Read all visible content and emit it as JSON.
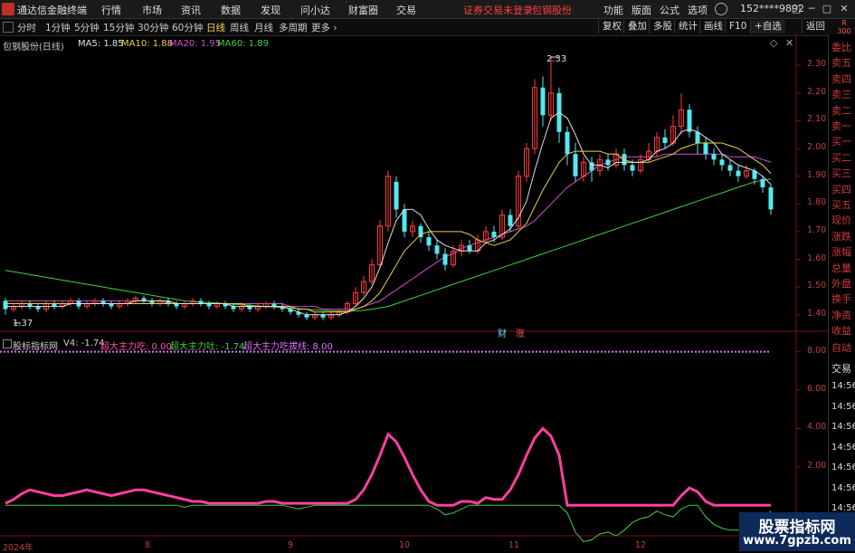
{
  "app": {
    "title": "通达信金融终端"
  },
  "menu": [
    "行情",
    "市场",
    "资讯",
    "数据",
    "发现",
    "问小达",
    "财富圈",
    "交易"
  ],
  "login_notice": "证券交易未登录",
  "stock_name": "包钢股份",
  "menu_right": [
    "功能",
    "版面",
    "公式",
    "选项"
  ],
  "user_id": "152****9892",
  "window_buttons": [
    "□",
    "─",
    "▢",
    "✕"
  ],
  "periods": [
    "分时",
    "1分钟",
    "5分钟",
    "15分钟",
    "30分钟",
    "60分钟",
    "日线",
    "周线",
    "月线",
    "多周期",
    "更多 ›"
  ],
  "active_period": "日线",
  "toolbar_right": [
    "复权",
    "叠加",
    "多股",
    "统计",
    "画线",
    "F10",
    "+自选",
    "返回"
  ],
  "badge": {
    "line1": "R",
    "line2": "300"
  },
  "main_info": {
    "label": "包钢股份(日线)",
    "ma": [
      {
        "text": "MA5: 1.85",
        "color": "#e0e0e0"
      },
      {
        "text": "MA10: 1.88",
        "color": "#e6d24a"
      },
      {
        "text": "MA20: 1.95",
        "color": "#d54ad5"
      },
      {
        "text": "MA60: 1.89",
        "color": "#3fd13f"
      }
    ]
  },
  "indicator_info": {
    "label": "股标指标网",
    "v4": "V4: -1.74",
    "items": [
      {
        "text": "超大主力吃: 0.00",
        "color": "#ff4fa0"
      },
      {
        "text": "超大主力吐: -1.74",
        "color": "#3fd13f"
      },
      {
        "text": "超大主力吃拔线: 8.00",
        "color": "#e070ff"
      }
    ]
  },
  "price_axis": [
    "2.30",
    "2.20",
    "2.10",
    "2.00",
    "1.90",
    "1.80",
    "1.70",
    "1.60",
    "1.50",
    "1.40"
  ],
  "ind_axis": [
    "8.00",
    "6.00",
    "4.00",
    "2.00"
  ],
  "annotations": {
    "high": "2.33",
    "low": "1.37",
    "mark_cai": "财",
    "mark_zhang": "涨"
  },
  "x_labels": [
    "2024年",
    "8",
    "9",
    "10",
    "11",
    "12"
  ],
  "side_panel": [
    "委比",
    "卖五",
    "卖四",
    "卖三",
    "卖二",
    "卖一",
    "买一",
    "买二",
    "买三",
    "买四",
    "买五",
    "现价",
    "涨跌",
    "涨幅",
    "总量",
    "外盘",
    "换手",
    "净资",
    "收益"
  ],
  "side_panel2": [
    "自动",
    "交易",
    "14:56",
    "14:56",
    "14:56",
    "14:56",
    "14:56",
    "14:56",
    "14:56",
    "14:56"
  ],
  "watermark": {
    "line1": "股票指标网",
    "line2": "www.7gpzb.com"
  },
  "chart_data": {
    "type": "candlestick",
    "price_range": [
      1.36,
      2.34
    ],
    "candles": [
      [
        1.45,
        1.42,
        1.46,
        1.4
      ],
      [
        1.42,
        1.43,
        1.44,
        1.41
      ],
      [
        1.43,
        1.44,
        1.45,
        1.42
      ],
      [
        1.44,
        1.43,
        1.45,
        1.42
      ],
      [
        1.43,
        1.42,
        1.44,
        1.41
      ],
      [
        1.42,
        1.44,
        1.45,
        1.41
      ],
      [
        1.44,
        1.43,
        1.45,
        1.42
      ],
      [
        1.43,
        1.44,
        1.45,
        1.42
      ],
      [
        1.44,
        1.45,
        1.46,
        1.43
      ],
      [
        1.45,
        1.43,
        1.46,
        1.42
      ],
      [
        1.43,
        1.44,
        1.45,
        1.42
      ],
      [
        1.44,
        1.45,
        1.46,
        1.43
      ],
      [
        1.45,
        1.44,
        1.46,
        1.43
      ],
      [
        1.44,
        1.43,
        1.45,
        1.42
      ],
      [
        1.43,
        1.44,
        1.45,
        1.42
      ],
      [
        1.44,
        1.45,
        1.46,
        1.43
      ],
      [
        1.45,
        1.46,
        1.47,
        1.44
      ],
      [
        1.46,
        1.45,
        1.47,
        1.44
      ],
      [
        1.45,
        1.44,
        1.46,
        1.43
      ],
      [
        1.44,
        1.45,
        1.46,
        1.43
      ],
      [
        1.45,
        1.44,
        1.46,
        1.43
      ],
      [
        1.44,
        1.43,
        1.45,
        1.42
      ],
      [
        1.43,
        1.44,
        1.45,
        1.42
      ],
      [
        1.44,
        1.45,
        1.46,
        1.43
      ],
      [
        1.45,
        1.44,
        1.46,
        1.43
      ],
      [
        1.44,
        1.43,
        1.45,
        1.42
      ],
      [
        1.43,
        1.44,
        1.45,
        1.42
      ],
      [
        1.44,
        1.43,
        1.45,
        1.42
      ],
      [
        1.43,
        1.42,
        1.44,
        1.41
      ],
      [
        1.42,
        1.43,
        1.44,
        1.41
      ],
      [
        1.43,
        1.42,
        1.44,
        1.41
      ],
      [
        1.42,
        1.43,
        1.44,
        1.41
      ],
      [
        1.43,
        1.44,
        1.45,
        1.42
      ],
      [
        1.44,
        1.43,
        1.45,
        1.42
      ],
      [
        1.43,
        1.42,
        1.44,
        1.41
      ],
      [
        1.42,
        1.41,
        1.43,
        1.4
      ],
      [
        1.41,
        1.4,
        1.42,
        1.39
      ],
      [
        1.4,
        1.39,
        1.41,
        1.38
      ],
      [
        1.39,
        1.4,
        1.41,
        1.38
      ],
      [
        1.4,
        1.39,
        1.41,
        1.38
      ],
      [
        1.39,
        1.4,
        1.41,
        1.38
      ],
      [
        1.4,
        1.41,
        1.42,
        1.39
      ],
      [
        1.41,
        1.44,
        1.45,
        1.4
      ],
      [
        1.44,
        1.48,
        1.5,
        1.43
      ],
      [
        1.48,
        1.52,
        1.54,
        1.47
      ],
      [
        1.52,
        1.58,
        1.6,
        1.51
      ],
      [
        1.58,
        1.72,
        1.74,
        1.57
      ],
      [
        1.72,
        1.9,
        1.92,
        1.7
      ],
      [
        1.88,
        1.78,
        1.9,
        1.75
      ],
      [
        1.78,
        1.7,
        1.8,
        1.68
      ],
      [
        1.7,
        1.72,
        1.74,
        1.68
      ],
      [
        1.72,
        1.68,
        1.73,
        1.66
      ],
      [
        1.68,
        1.65,
        1.7,
        1.63
      ],
      [
        1.65,
        1.62,
        1.67,
        1.6
      ],
      [
        1.62,
        1.58,
        1.64,
        1.56
      ],
      [
        1.58,
        1.63,
        1.65,
        1.57
      ],
      [
        1.63,
        1.65,
        1.67,
        1.61
      ],
      [
        1.65,
        1.63,
        1.67,
        1.62
      ],
      [
        1.63,
        1.67,
        1.69,
        1.62
      ],
      [
        1.67,
        1.7,
        1.72,
        1.66
      ],
      [
        1.7,
        1.68,
        1.72,
        1.66
      ],
      [
        1.68,
        1.76,
        1.78,
        1.67
      ],
      [
        1.76,
        1.72,
        1.78,
        1.7
      ],
      [
        1.72,
        1.9,
        1.92,
        1.71
      ],
      [
        1.9,
        2.0,
        2.02,
        1.88
      ],
      [
        2.0,
        2.22,
        2.25,
        1.98
      ],
      [
        2.22,
        2.12,
        2.26,
        2.08
      ],
      [
        2.12,
        2.2,
        2.33,
        2.1
      ],
      [
        2.2,
        2.06,
        2.22,
        2.02
      ],
      [
        2.06,
        1.98,
        2.08,
        1.94
      ],
      [
        1.98,
        1.9,
        2.02,
        1.88
      ],
      [
        1.9,
        1.95,
        1.97,
        1.88
      ],
      [
        1.95,
        1.92,
        1.97,
        1.88
      ],
      [
        1.92,
        1.96,
        1.98,
        1.9
      ],
      [
        1.96,
        1.94,
        1.98,
        1.92
      ],
      [
        1.94,
        1.98,
        2.0,
        1.93
      ],
      [
        1.98,
        1.94,
        2.0,
        1.92
      ],
      [
        1.94,
        1.92,
        1.96,
        1.9
      ],
      [
        1.92,
        1.96,
        1.98,
        1.91
      ],
      [
        1.96,
        1.99,
        2.02,
        1.95
      ],
      [
        1.99,
        2.04,
        2.06,
        1.97
      ],
      [
        2.04,
        2.02,
        2.07,
        2.0
      ],
      [
        2.02,
        2.08,
        2.12,
        2.01
      ],
      [
        2.08,
        2.14,
        2.2,
        2.05
      ],
      [
        2.14,
        2.06,
        2.16,
        2.04
      ],
      [
        2.06,
        2.02,
        2.08,
        1.98
      ],
      [
        2.02,
        1.98,
        2.04,
        1.96
      ],
      [
        1.98,
        1.96,
        2.0,
        1.94
      ],
      [
        1.96,
        1.94,
        1.98,
        1.92
      ],
      [
        1.94,
        1.92,
        1.96,
        1.9
      ],
      [
        1.92,
        1.9,
        1.94,
        1.88
      ],
      [
        1.9,
        1.92,
        1.94,
        1.89
      ],
      [
        1.92,
        1.89,
        1.93,
        1.87
      ],
      [
        1.89,
        1.86,
        1.9,
        1.84
      ],
      [
        1.86,
        1.78,
        1.87,
        1.76
      ]
    ],
    "ma5": [
      1.43,
      1.43,
      1.43,
      1.43,
      1.43,
      1.43,
      1.43,
      1.43,
      1.44,
      1.44,
      1.44,
      1.44,
      1.44,
      1.44,
      1.44,
      1.44,
      1.45,
      1.45,
      1.45,
      1.45,
      1.45,
      1.44,
      1.44,
      1.44,
      1.44,
      1.44,
      1.44,
      1.44,
      1.43,
      1.43,
      1.43,
      1.43,
      1.43,
      1.43,
      1.43,
      1.42,
      1.41,
      1.4,
      1.4,
      1.4,
      1.4,
      1.4,
      1.41,
      1.43,
      1.46,
      1.5,
      1.57,
      1.66,
      1.74,
      1.78,
      1.78,
      1.76,
      1.71,
      1.67,
      1.65,
      1.64,
      1.63,
      1.63,
      1.63,
      1.66,
      1.67,
      1.69,
      1.71,
      1.75,
      1.81,
      1.92,
      2.02,
      2.11,
      2.13,
      2.11,
      2.05,
      1.98,
      1.94,
      1.94,
      1.93,
      1.95,
      1.95,
      1.95,
      1.95,
      1.96,
      1.99,
      2.0,
      2.02,
      2.06,
      2.07,
      2.06,
      2.04,
      2.02,
      1.98,
      1.96,
      1.94,
      1.93,
      1.92,
      1.9,
      1.87
    ],
    "ma10": [
      1.44,
      1.44,
      1.44,
      1.44,
      1.44,
      1.44,
      1.44,
      1.44,
      1.44,
      1.44,
      1.44,
      1.44,
      1.44,
      1.44,
      1.44,
      1.44,
      1.44,
      1.44,
      1.44,
      1.44,
      1.44,
      1.44,
      1.44,
      1.44,
      1.44,
      1.44,
      1.44,
      1.44,
      1.44,
      1.44,
      1.43,
      1.43,
      1.43,
      1.43,
      1.43,
      1.43,
      1.42,
      1.42,
      1.41,
      1.41,
      1.41,
      1.41,
      1.41,
      1.42,
      1.43,
      1.45,
      1.48,
      1.53,
      1.58,
      1.63,
      1.66,
      1.69,
      1.7,
      1.7,
      1.7,
      1.7,
      1.7,
      1.69,
      1.67,
      1.66,
      1.65,
      1.66,
      1.67,
      1.7,
      1.73,
      1.79,
      1.85,
      1.9,
      1.95,
      1.98,
      1.99,
      1.99,
      1.99,
      1.99,
      1.98,
      1.98,
      1.96,
      1.95,
      1.95,
      1.95,
      1.96,
      1.97,
      1.98,
      2.0,
      2.01,
      2.02,
      2.02,
      2.02,
      2.02,
      2.01,
      2.0,
      1.98,
      1.96,
      1.94,
      1.91
    ],
    "ma20": [
      1.45,
      1.45,
      1.45,
      1.45,
      1.45,
      1.45,
      1.45,
      1.45,
      1.45,
      1.45,
      1.45,
      1.45,
      1.45,
      1.45,
      1.45,
      1.45,
      1.45,
      1.45,
      1.45,
      1.45,
      1.44,
      1.44,
      1.44,
      1.44,
      1.44,
      1.44,
      1.44,
      1.44,
      1.44,
      1.44,
      1.44,
      1.44,
      1.44,
      1.44,
      1.44,
      1.43,
      1.43,
      1.43,
      1.43,
      1.42,
      1.42,
      1.42,
      1.42,
      1.42,
      1.43,
      1.44,
      1.45,
      1.47,
      1.49,
      1.51,
      1.53,
      1.55,
      1.57,
      1.59,
      1.61,
      1.62,
      1.64,
      1.65,
      1.66,
      1.67,
      1.68,
      1.69,
      1.7,
      1.71,
      1.72,
      1.74,
      1.77,
      1.8,
      1.83,
      1.86,
      1.88,
      1.9,
      1.92,
      1.94,
      1.95,
      1.96,
      1.97,
      1.97,
      1.97,
      1.97,
      1.97,
      1.98,
      1.98,
      1.98,
      1.98,
      1.98,
      1.98,
      1.98,
      1.98,
      1.97,
      1.97,
      1.97,
      1.97,
      1.96,
      1.95
    ],
    "ma60": [
      1.56,
      1.555,
      1.55,
      1.545,
      1.54,
      1.535,
      1.53,
      1.525,
      1.52,
      1.515,
      1.51,
      1.505,
      1.5,
      1.495,
      1.49,
      1.485,
      1.48,
      1.475,
      1.47,
      1.465,
      1.46,
      1.455,
      1.45,
      1.448,
      1.446,
      1.444,
      1.442,
      1.44,
      1.438,
      1.436,
      1.434,
      1.432,
      1.43,
      1.428,
      1.426,
      1.424,
      1.422,
      1.42,
      1.418,
      1.416,
      1.415,
      1.414,
      1.413,
      1.414,
      1.416,
      1.42,
      1.425,
      1.43,
      1.44,
      1.45,
      1.46,
      1.47,
      1.48,
      1.49,
      1.5,
      1.51,
      1.52,
      1.53,
      1.54,
      1.55,
      1.56,
      1.57,
      1.58,
      1.59,
      1.6,
      1.61,
      1.62,
      1.63,
      1.64,
      1.65,
      1.66,
      1.67,
      1.68,
      1.69,
      1.7,
      1.71,
      1.72,
      1.73,
      1.74,
      1.75,
      1.76,
      1.77,
      1.78,
      1.79,
      1.8,
      1.81,
      1.82,
      1.83,
      1.84,
      1.85,
      1.86,
      1.87,
      1.88,
      1.885,
      1.89
    ],
    "indicator": {
      "range": [
        -1.5,
        8.5
      ],
      "magenta_baseline": 8.0,
      "pink": [
        0.1,
        0.3,
        0.6,
        0.8,
        0.7,
        0.6,
        0.5,
        0.5,
        0.6,
        0.7,
        0.8,
        0.7,
        0.6,
        0.5,
        0.6,
        0.7,
        0.8,
        0.8,
        0.7,
        0.6,
        0.5,
        0.4,
        0.3,
        0.2,
        0.2,
        0.1,
        0.1,
        0.1,
        0.1,
        0.1,
        0.1,
        0.1,
        0.2,
        0.2,
        0.1,
        0.1,
        0.1,
        0.1,
        0.1,
        0.1,
        0.1,
        0.1,
        0.1,
        0.3,
        0.8,
        1.6,
        2.6,
        3.7,
        3.3,
        2.5,
        1.6,
        0.8,
        0.2,
        0.0,
        0.0,
        0.0,
        0.2,
        0.2,
        0.1,
        0.4,
        0.3,
        0.3,
        0.8,
        1.6,
        2.6,
        3.5,
        4.0,
        3.6,
        2.6,
        0.0,
        0.0,
        0.0,
        0.0,
        0.0,
        0.0,
        0.0,
        0.0,
        0.0,
        0.0,
        0.0,
        0.0,
        0.0,
        0.0,
        0.5,
        0.9,
        0.7,
        0.2,
        0.0,
        0.0,
        0.0,
        0.0,
        0.0,
        0.0,
        0.0,
        0.0
      ],
      "green": [
        0.0,
        0.0,
        0.0,
        0.0,
        0.0,
        0.0,
        0.0,
        0.0,
        0.0,
        0.0,
        0.0,
        0.0,
        0.0,
        0.0,
        0.0,
        0.0,
        0.0,
        0.0,
        0.0,
        0.0,
        0.0,
        0.0,
        -0.1,
        0.0,
        0.0,
        0.0,
        0.0,
        0.0,
        0.0,
        0.0,
        0.0,
        0.0,
        0.0,
        0.0,
        0.0,
        -0.1,
        -0.2,
        -0.1,
        0.0,
        0.0,
        0.0,
        0.0,
        0.0,
        0.0,
        0.0,
        0.0,
        0.0,
        0.0,
        0.0,
        0.0,
        0.0,
        0.0,
        0.0,
        -0.2,
        -0.5,
        -0.4,
        -0.2,
        0.0,
        0.0,
        0.0,
        0.0,
        0.0,
        0.0,
        0.0,
        0.0,
        0.0,
        0.0,
        0.0,
        0.0,
        -0.4,
        -1.4,
        -1.9,
        -1.8,
        -1.5,
        -1.4,
        -1.6,
        -1.3,
        -0.9,
        -0.7,
        -0.6,
        -0.3,
        -0.5,
        -0.6,
        -0.2,
        0.0,
        0.0,
        -0.6,
        -1.0,
        -1.2,
        -1.3,
        -1.3,
        -1.3,
        -1.2,
        -0.7,
        -0.3
      ]
    }
  }
}
